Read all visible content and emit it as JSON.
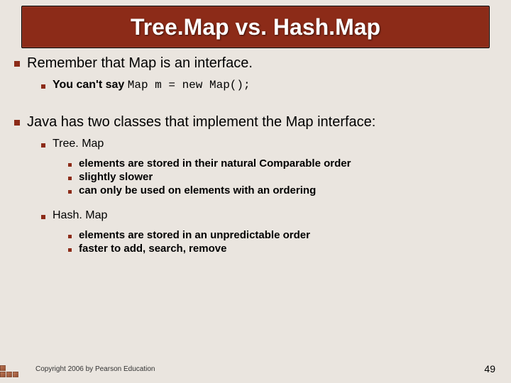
{
  "title": "Tree.Map vs. Hash.Map",
  "points": {
    "p1": "Remember that Map is an interface.",
    "p1a_prefix": "You can't say ",
    "p1a_code": "Map m = new Map();",
    "p2": "Java has two classes that implement the Map interface:",
    "p2a": "Tree. Map",
    "p2a1": "elements are stored in their natural Comparable order",
    "p2a2": "slightly slower",
    "p2a3": "can only be used on elements with an ordering",
    "p2b": "Hash. Map",
    "p2b1": "elements are stored in an unpredictable order",
    "p2b2": "faster to add, search, remove"
  },
  "footer": "Copyright 2006 by Pearson Education",
  "page_number": "49"
}
